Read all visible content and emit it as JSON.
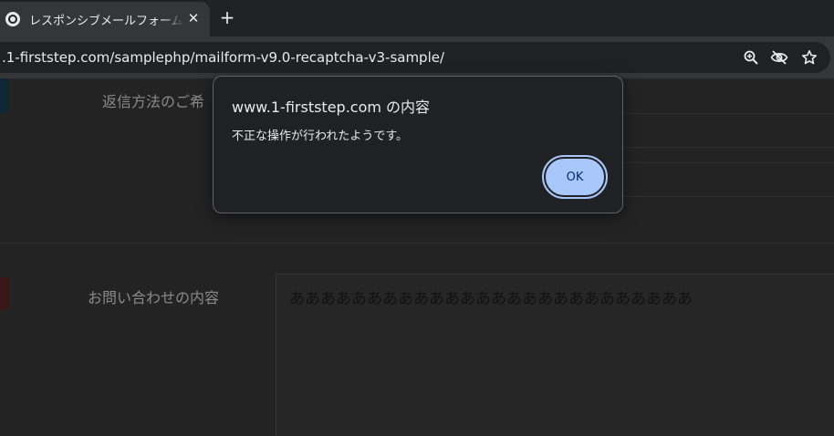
{
  "browser": {
    "tab": {
      "title": "レスポンシブメールフォームの",
      "close_glyph": "✕"
    },
    "new_tab_glyph": "+",
    "url": ".1-firststep.com/samplephp/mailform-v9.0-recaptcha-v3-sample/",
    "icons": [
      "zoom-icon",
      "eye-off-icon",
      "star-icon"
    ]
  },
  "page": {
    "labels": {
      "reply_method": "返信方法のご希",
      "inquiry_content": "お問い合わせの内容"
    },
    "inquiry_text": "ああああああああああああああああああああああああああ",
    "marker_colors": {
      "reply_method": "#0f2733",
      "inquiry_content": "#3a1616"
    }
  },
  "dialog": {
    "title": "www.1-firststep.com の内容",
    "message": "不正な操作が行われたようです。",
    "ok_label": "OK"
  }
}
